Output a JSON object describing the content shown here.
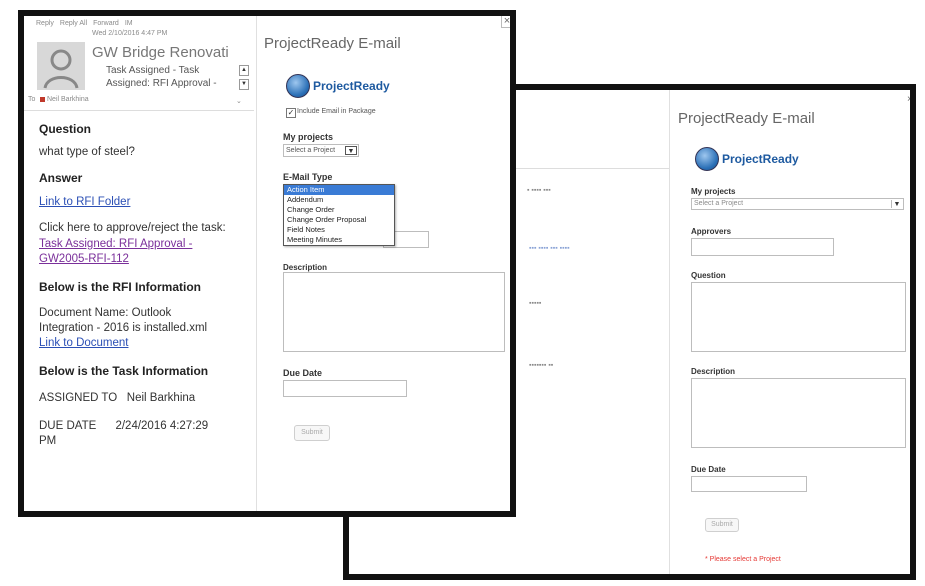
{
  "back": {
    "title": "ProjectReady E-mail",
    "logo_text": "ProjectReady",
    "my_projects_label": "My projects",
    "select_placeholder": "Select a Project",
    "approvers_label": "Approvers",
    "question_label": "Question",
    "description_label": "Description",
    "due_date_label": "Due Date",
    "submit_label": "Submit",
    "error_text": "* Please select a Project",
    "close_glyph": "×"
  },
  "front_email": {
    "toolbar": [
      "Reply",
      "Reply All",
      "Forward",
      "IM"
    ],
    "date": "Wed 2/10/2016 4:47 PM",
    "sender": "GW Bridge Renovati",
    "subject_line1": "Task Assigned - Task",
    "subject_line2": "Assigned: RFI Approval -",
    "to_label": "To",
    "to_name": "Neil Barkhina",
    "question_heading": "Question",
    "question_text": "what type of steel?",
    "answer_heading": "Answer",
    "rfi_link": "Link to RFI Folder",
    "approve_text": "Click here to approve/reject the task:",
    "task_link_line1": "Task Assigned: RFI Approval -",
    "task_link_line2": "GW2005-RFI-112",
    "rfi_info_heading": "Below is the RFI Information",
    "doc_name_line1": "Document Name: Outlook",
    "doc_name_line2": "Integration - 2016 is installed.xml",
    "doc_link": "Link to Document",
    "task_info_heading": "Below is the Task Information",
    "assigned_to": "ASSIGNED TO   Neil Barkhina",
    "due_date_line1": "DUE DATE      2/24/2016 4:27:29",
    "due_date_line2": "PM"
  },
  "front_panel": {
    "title": "ProjectReady E-mail",
    "logo_text": "ProjectReady",
    "include_email": "Include Email in Package",
    "my_projects_label": "My projects",
    "select_placeholder": "Select a Project",
    "email_type_label": "E-Mail Type",
    "email_types": [
      "Action Item",
      "Addendum",
      "Change Order",
      "Change Order Proposal",
      "Field Notes",
      "Meeting Minutes"
    ],
    "selected_index": 0,
    "description_label": "Description",
    "due_date_label": "Due Date",
    "submit_label": "Submit",
    "close_glyph": "×"
  },
  "colors": {
    "frame": "#111111",
    "link": "#2b4fb5",
    "visited": "#7a2f9a",
    "error": "#e53935",
    "highlight": "#3a7bd5"
  }
}
